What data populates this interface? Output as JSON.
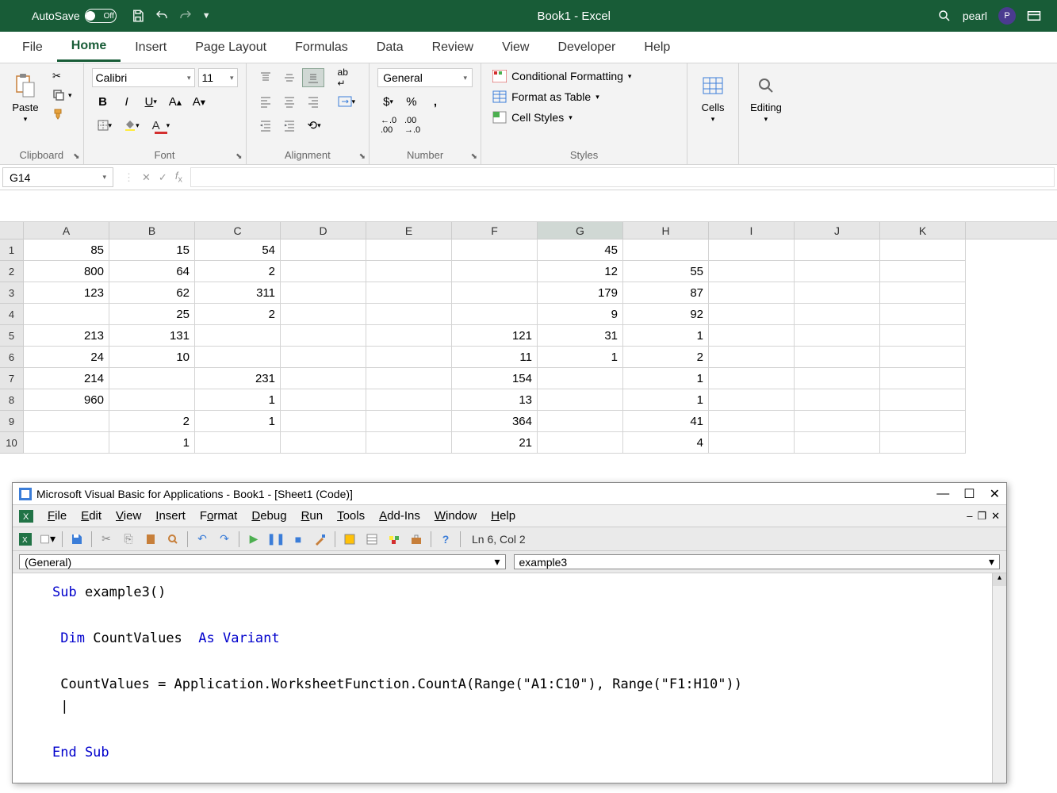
{
  "titlebar": {
    "autosave_label": "AutoSave",
    "autosave_state": "Off",
    "document_title": "Book1 - Excel",
    "user_name": "pearl",
    "user_initial": "P"
  },
  "ribbon": {
    "tabs": [
      "File",
      "Home",
      "Insert",
      "Page Layout",
      "Formulas",
      "Data",
      "Review",
      "View",
      "Developer",
      "Help"
    ],
    "active_tab": "Home",
    "clipboard": {
      "paste_label": "Paste",
      "group_label": "Clipboard"
    },
    "font": {
      "name": "Calibri",
      "size": "11",
      "group_label": "Font"
    },
    "alignment": {
      "group_label": "Alignment"
    },
    "number": {
      "format": "General",
      "group_label": "Number"
    },
    "styles": {
      "conditional": "Conditional Formatting",
      "table": "Format as Table",
      "cell": "Cell Styles",
      "group_label": "Styles"
    },
    "cells": {
      "label": "Cells"
    },
    "editing": {
      "label": "Editing"
    }
  },
  "formula_bar": {
    "name_box": "G14",
    "formula": ""
  },
  "sheet": {
    "columns": [
      "A",
      "B",
      "C",
      "D",
      "E",
      "F",
      "G",
      "H",
      "I",
      "J",
      "K"
    ],
    "selected_col": "G",
    "rows": [
      {
        "n": "1",
        "A": "85",
        "B": "15",
        "C": "54",
        "D": "",
        "E": "",
        "F": "",
        "G": "45",
        "H": "",
        "I": "",
        "J": "",
        "K": ""
      },
      {
        "n": "2",
        "A": "800",
        "B": "64",
        "C": "2",
        "D": "",
        "E": "",
        "F": "",
        "G": "12",
        "H": "55",
        "I": "",
        "J": "",
        "K": ""
      },
      {
        "n": "3",
        "A": "123",
        "B": "62",
        "C": "311",
        "D": "",
        "E": "",
        "F": "",
        "G": "179",
        "H": "87",
        "I": "",
        "J": "",
        "K": ""
      },
      {
        "n": "4",
        "A": "",
        "B": "25",
        "C": "2",
        "D": "",
        "E": "",
        "F": "",
        "G": "9",
        "H": "92",
        "I": "",
        "J": "",
        "K": ""
      },
      {
        "n": "5",
        "A": "213",
        "B": "131",
        "C": "",
        "D": "",
        "E": "",
        "F": "121",
        "G": "31",
        "H": "1",
        "I": "",
        "J": "",
        "K": ""
      },
      {
        "n": "6",
        "A": "24",
        "B": "10",
        "C": "",
        "D": "",
        "E": "",
        "F": "11",
        "G": "1",
        "H": "2",
        "I": "",
        "J": "",
        "K": ""
      },
      {
        "n": "7",
        "A": "214",
        "B": "",
        "C": "231",
        "D": "",
        "E": "",
        "F": "154",
        "G": "",
        "H": "1",
        "I": "",
        "J": "",
        "K": ""
      },
      {
        "n": "8",
        "A": "960",
        "B": "",
        "C": "1",
        "D": "",
        "E": "",
        "F": "13",
        "G": "",
        "H": "1",
        "I": "",
        "J": "",
        "K": ""
      },
      {
        "n": "9",
        "A": "",
        "B": "2",
        "C": "1",
        "D": "",
        "E": "",
        "F": "364",
        "G": "",
        "H": "41",
        "I": "",
        "J": "",
        "K": ""
      },
      {
        "n": "10",
        "A": "",
        "B": "1",
        "C": "",
        "D": "",
        "E": "",
        "F": "21",
        "G": "",
        "H": "4",
        "I": "",
        "J": "",
        "K": ""
      }
    ]
  },
  "vba": {
    "title": "Microsoft Visual Basic for Applications - Book1 - [Sheet1 (Code)]",
    "menu": [
      "File",
      "Edit",
      "View",
      "Insert",
      "Format",
      "Debug",
      "Run",
      "Tools",
      "Add-Ins",
      "Window",
      "Help"
    ],
    "cursor_status": "Ln 6, Col 2",
    "dropdown_left": "(General)",
    "dropdown_right": "example3",
    "code": {
      "l1a": "Sub ",
      "l1b": "example3()",
      "l2a": "Dim ",
      "l2b": "CountValues  ",
      "l2c": "As Variant",
      "l3": "CountValues = Application.WorksheetFunction.CountA(Range(\"A1:C10\"), Range(\"F1:H10\"))",
      "l4": "|",
      "l5": "End Sub"
    }
  }
}
